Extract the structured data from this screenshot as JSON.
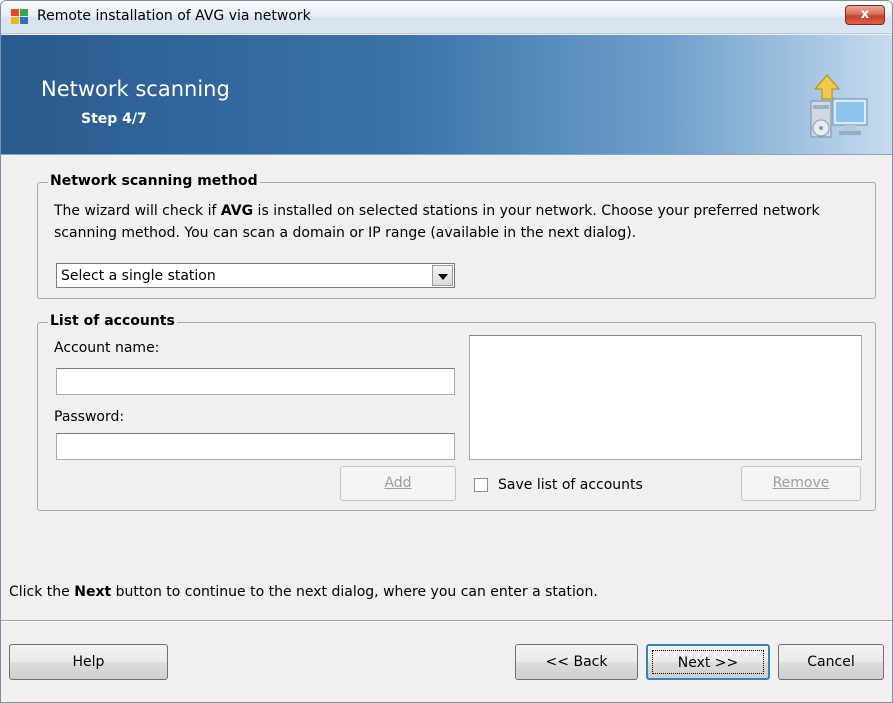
{
  "window": {
    "title": "Remote installation of AVG via network",
    "close_glyph": "x"
  },
  "banner": {
    "title": "Network scanning",
    "step": "Step 4/7",
    "icon": "computer-install-icon"
  },
  "scan_method": {
    "legend": "Network scanning method",
    "desc_part1": "The wizard will check if ",
    "desc_brand": "AVG",
    "desc_part2": " is installed on selected stations in your network. Choose your preferred network scanning method. You can scan a domain or IP range (available in the next dialog).",
    "selected_method": "Select a single station"
  },
  "accounts": {
    "legend": "List of accounts",
    "account_name_label": "Account name:",
    "account_name_value": "",
    "password_label": "Password:",
    "password_value": "",
    "add_label": "Add",
    "save_list_label": "Save list of accounts",
    "save_list_checked": false,
    "remove_label": "Remove"
  },
  "hint": {
    "prefix": "Click the ",
    "keyword": "Next",
    "suffix": " button to continue to the next dialog, where you can enter a station."
  },
  "footer": {
    "help_label": "Help",
    "back_label": "<< Back",
    "next_label": "Next >>",
    "cancel_label": "Cancel"
  },
  "colors": {
    "banner_dark": "#2a5a8e",
    "banner_light": "#c6dbee",
    "close_red": "#c7432b"
  }
}
